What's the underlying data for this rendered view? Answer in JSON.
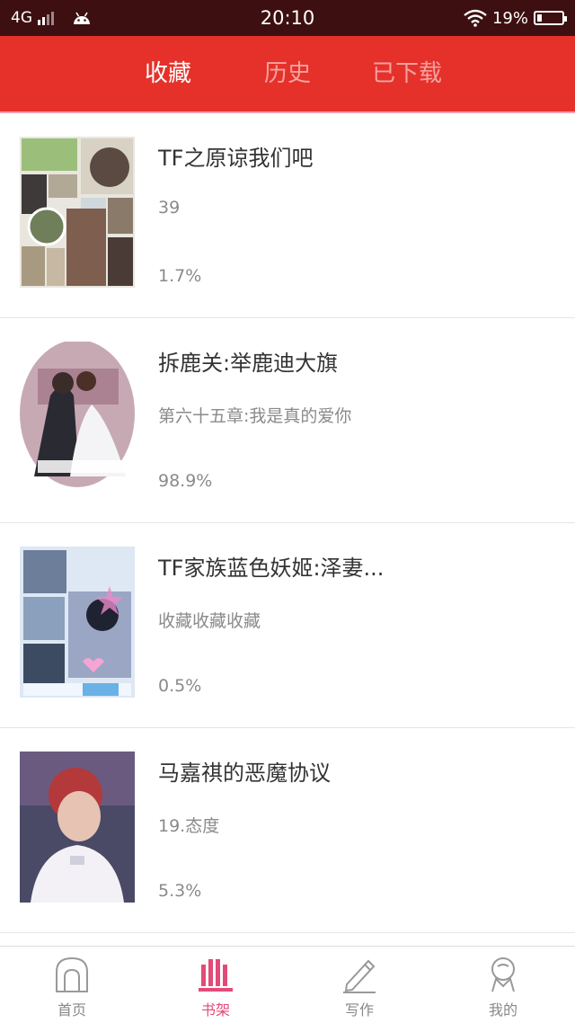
{
  "status_bar": {
    "network": "4G",
    "time": "20:10",
    "battery": "19%",
    "battery_level": 0.19
  },
  "tabs": [
    {
      "label": "收藏",
      "active": true
    },
    {
      "label": "历史",
      "active": false
    },
    {
      "label": "已下载",
      "active": false
    }
  ],
  "books": [
    {
      "title": "TF之原谅我们吧",
      "chapter": "39",
      "progress": "1.7%"
    },
    {
      "title": "拆鹿关:举鹿迪大旗",
      "chapter": "第六十五章:我是真的爱你",
      "progress": "98.9%"
    },
    {
      "title": "TF家族蓝色妖姬:泽妻...",
      "chapter": "收藏收藏收藏",
      "progress": "0.5%"
    },
    {
      "title": "马嘉祺的恶魔协议",
      "chapter": "19.态度",
      "progress": "5.3%"
    }
  ],
  "bottom_nav": [
    {
      "label": "首页",
      "icon": "home-icon",
      "active": false
    },
    {
      "label": "书架",
      "icon": "bookshelf-icon",
      "active": true
    },
    {
      "label": "写作",
      "icon": "pencil-icon",
      "active": false
    },
    {
      "label": "我的",
      "icon": "profile-icon",
      "active": false
    }
  ],
  "colors": {
    "header": "#e5312a",
    "status_bar": "#3d0f10",
    "active_nav": "#e24b78"
  }
}
